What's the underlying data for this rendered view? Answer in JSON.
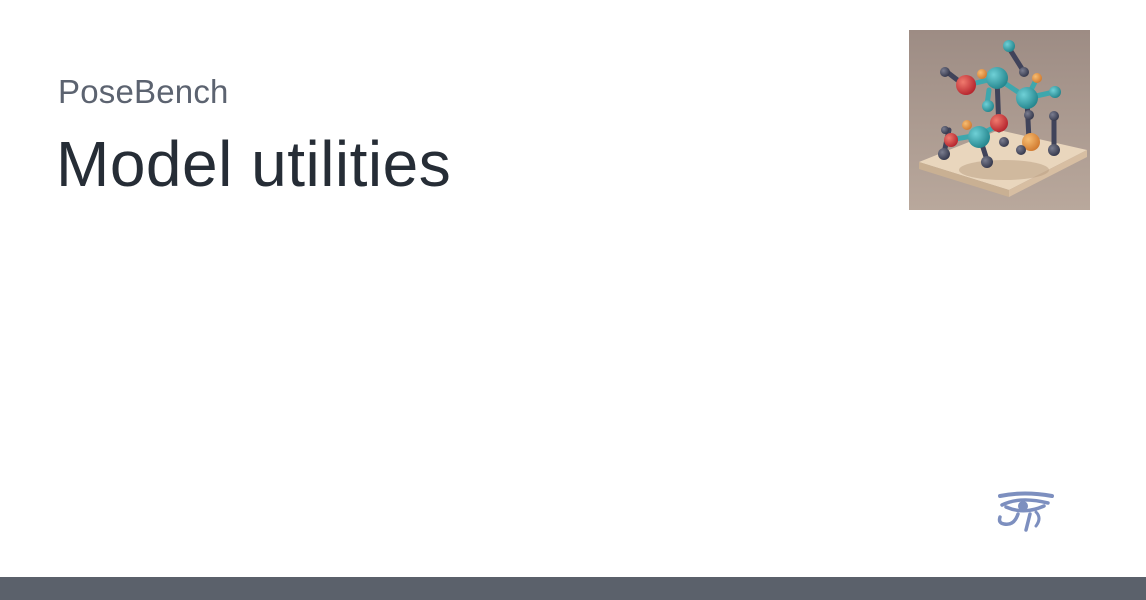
{
  "site": {
    "name": "PoseBench"
  },
  "page": {
    "title": "Model utilities"
  },
  "icons": {
    "logo": "molecule-logo-icon",
    "theme": "eye-of-horus-icon"
  },
  "colors": {
    "site_name": "#5c6370",
    "title": "#262d36",
    "footer_bar": "#5b616b",
    "theme_icon": "#7d8fbf"
  }
}
